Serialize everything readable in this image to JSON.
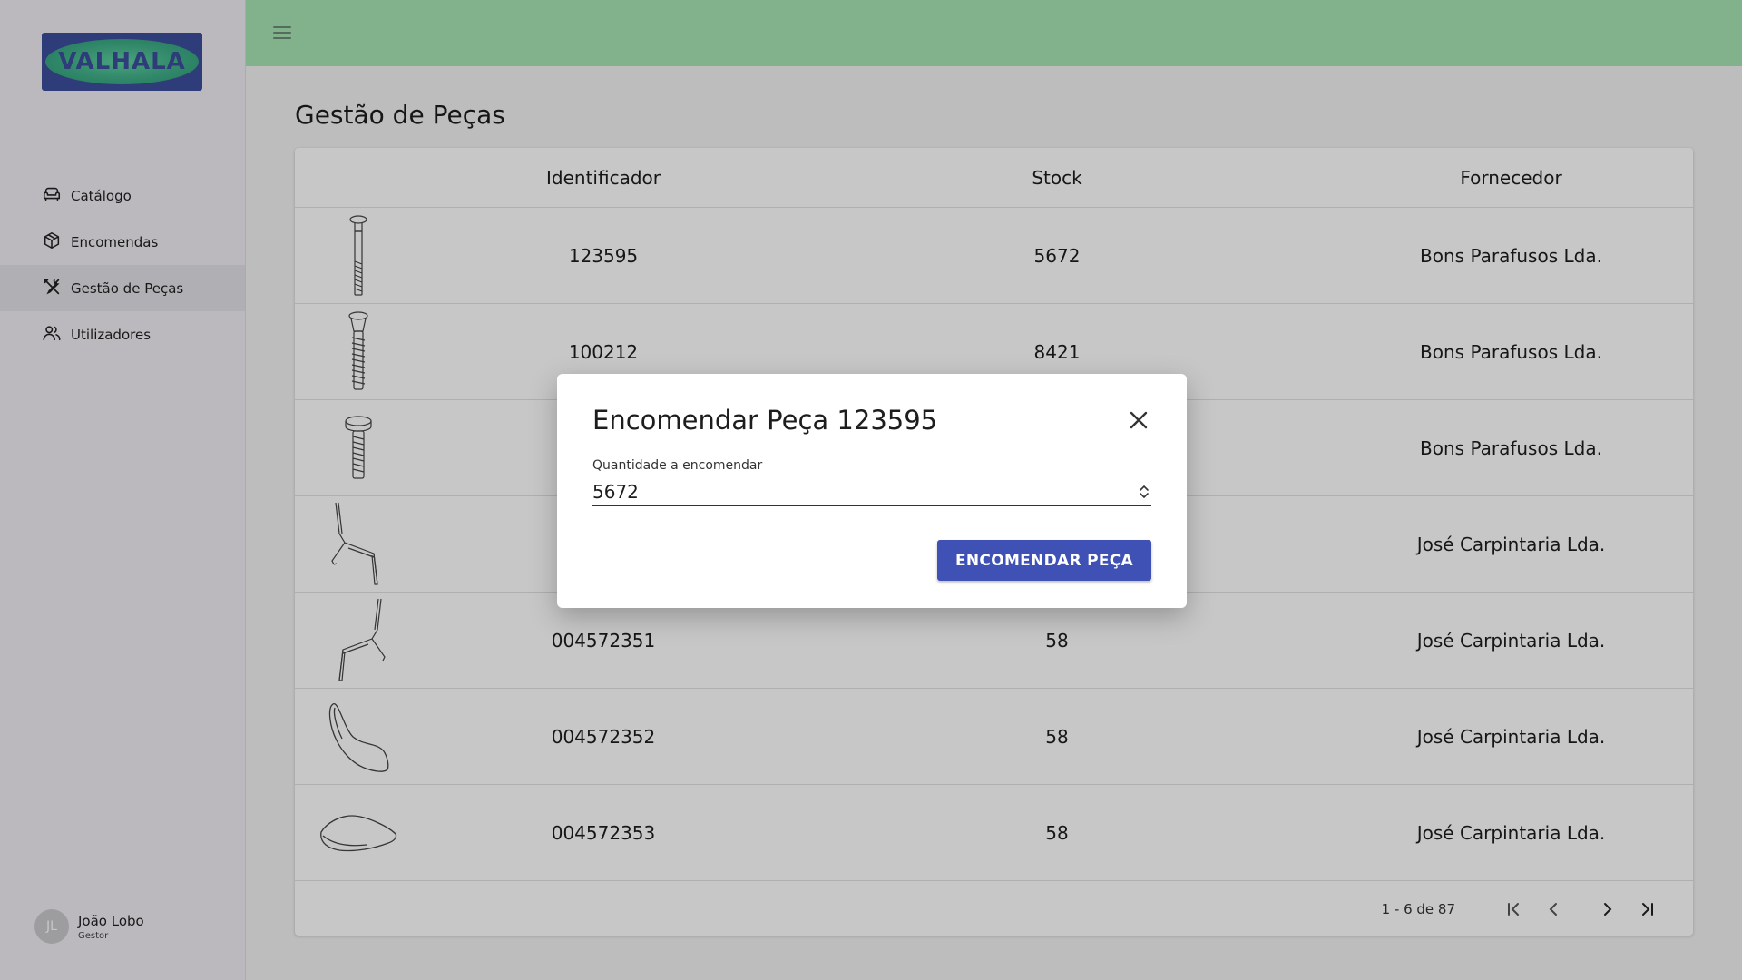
{
  "app": {
    "logo_text": "VALHALA"
  },
  "sidebar": {
    "items": [
      {
        "label": "Catálogo",
        "icon": "sofa-icon"
      },
      {
        "label": "Encomendas",
        "icon": "package-icon"
      },
      {
        "label": "Gestão de Peças",
        "icon": "tools-icon",
        "active": true
      },
      {
        "label": "Utilizadores",
        "icon": "users-icon"
      }
    ],
    "user": {
      "initials": "JL",
      "name": "João Lobo",
      "role": "Gestor"
    }
  },
  "page": {
    "title": "Gestão de Peças"
  },
  "table": {
    "headers": {
      "image": "",
      "id": "Identificador",
      "stock": "Stock",
      "supplier": "Fornecedor"
    },
    "rows": [
      {
        "image": "screw-long",
        "id": "123595",
        "stock": "5672",
        "supplier": "Bons Parafusos Lda."
      },
      {
        "image": "screw-wood",
        "id": "100212",
        "stock": "8421",
        "supplier": "Bons Parafusos Lda."
      },
      {
        "image": "screw-short",
        "id": "",
        "stock": "",
        "supplier": "Bons Parafusos Lda."
      },
      {
        "image": "chair-frame-left",
        "id": "",
        "stock": "",
        "supplier": "José Carpintaria Lda."
      },
      {
        "image": "chair-frame-right",
        "id": "004572351",
        "stock": "58",
        "supplier": "José Carpintaria Lda."
      },
      {
        "image": "chair-backrest",
        "id": "004572352",
        "stock": "58",
        "supplier": "José Carpintaria Lda."
      },
      {
        "image": "chair-seat",
        "id": "004572353",
        "stock": "58",
        "supplier": "José Carpintaria Lda."
      }
    ],
    "paginator": {
      "range": "1 - 6 de 87"
    }
  },
  "dialog": {
    "title": "Encomendar Peça 123595",
    "field_label": "Quantidade a encomendar",
    "field_value": "5672",
    "button_label": "ENCOMENDAR PEÇA"
  },
  "colors": {
    "topbar": "#a6e5b4",
    "primary": "#3f51b5",
    "logo_bg": "#3b4f9c",
    "logo_ellipse": "#3fae87"
  }
}
